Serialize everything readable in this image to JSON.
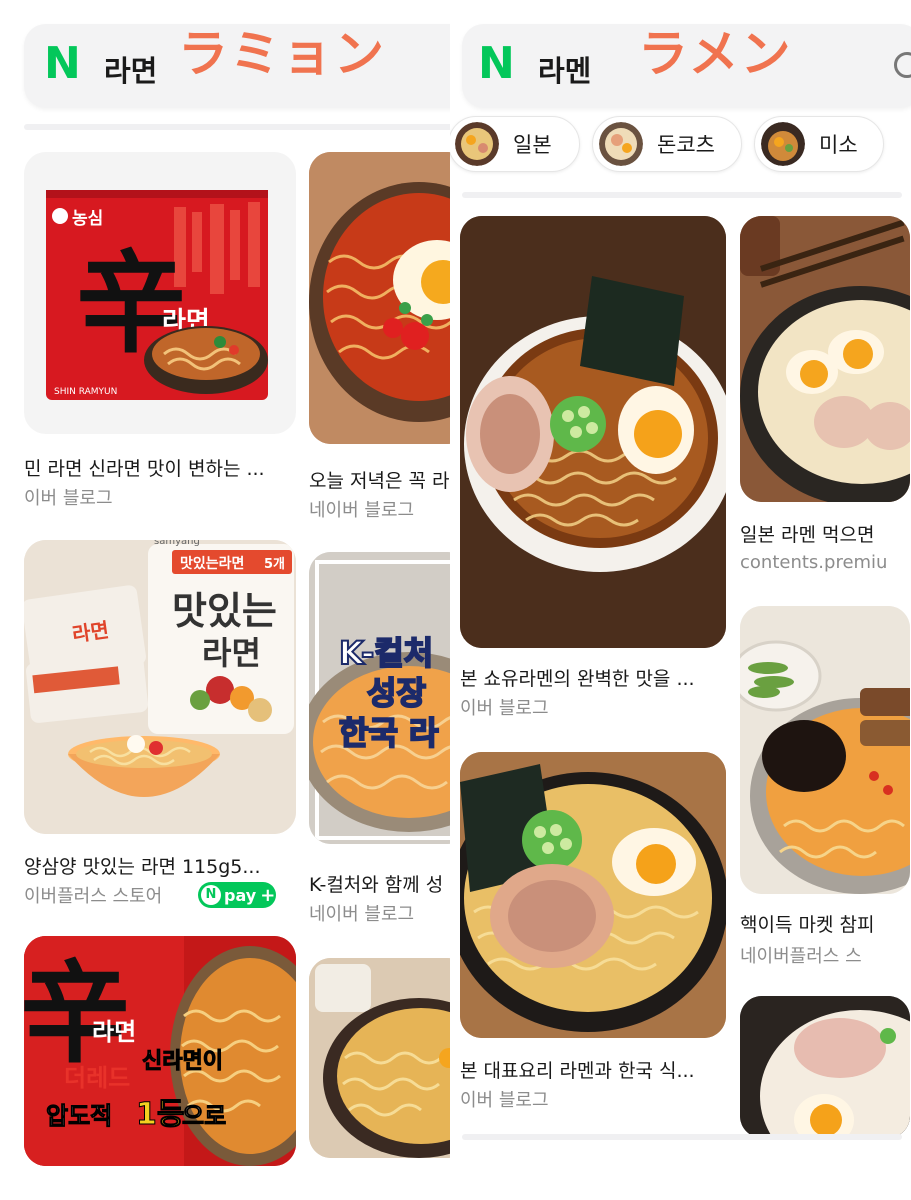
{
  "left": {
    "logo": "N",
    "query": "라면",
    "overlay_katakana": "ラミョン",
    "cards": [
      {
        "title": "민 라면 신라면 맛이 변하는 ...",
        "source": "이버 블로그"
      },
      {
        "title": "오늘 저녁은 꼭 라",
        "source": "네이버 블로그"
      },
      {
        "title": "양삼양 맛있는 라면 115g5...",
        "source": "이버플러스 스토어"
      },
      {
        "title": "K-컬처와 함께 성",
        "source": "네이버 블로그"
      }
    ],
    "npay_label": "pay",
    "npay_n": "N",
    "npay_plus": "+",
    "shin_pack": {
      "brand": "농심",
      "logo_char": "辛",
      "product": "라면",
      "english": "SHIN RAMYUN"
    },
    "samyang_pack": {
      "brand": "samyang",
      "ribbon": "맛있는라면",
      "count": "5개",
      "name_line1": "맛있는",
      "name_line2": "라면",
      "side_label": "라면"
    },
    "kculture": {
      "line1": "K-컬처",
      "line2": "성장",
      "line3": "한국 라"
    },
    "bottom_card": {
      "logo_char": "辛",
      "product": "라면",
      "line1": "신라면이",
      "line2_a": "압도적 ",
      "line2_b": "1등",
      "line2_c": "으로",
      "red_label": "더레드"
    }
  },
  "right": {
    "logo": "N",
    "query": "라멘",
    "overlay_katakana": "ラメン",
    "chips": [
      {
        "label": "일본"
      },
      {
        "label": "돈코츠"
      },
      {
        "label": "미소"
      }
    ],
    "cards": [
      {
        "title": "본 쇼유라멘의 완벽한 맛을 ...",
        "source": "이버 블로그"
      },
      {
        "title": "일본 라멘 먹으면",
        "source": "contents.premiu"
      },
      {
        "title": "본 대표요리 라멘과 한국 식...",
        "source": "이버 블로그"
      },
      {
        "title": "핵이득 마켓 참피",
        "source": "네이버플러스 스"
      }
    ]
  },
  "colors": {
    "naver_green": "#03c75a",
    "overlay_orange": "#f0734f",
    "shin_red": "#d71920",
    "source_gray": "#8c8c8c"
  }
}
